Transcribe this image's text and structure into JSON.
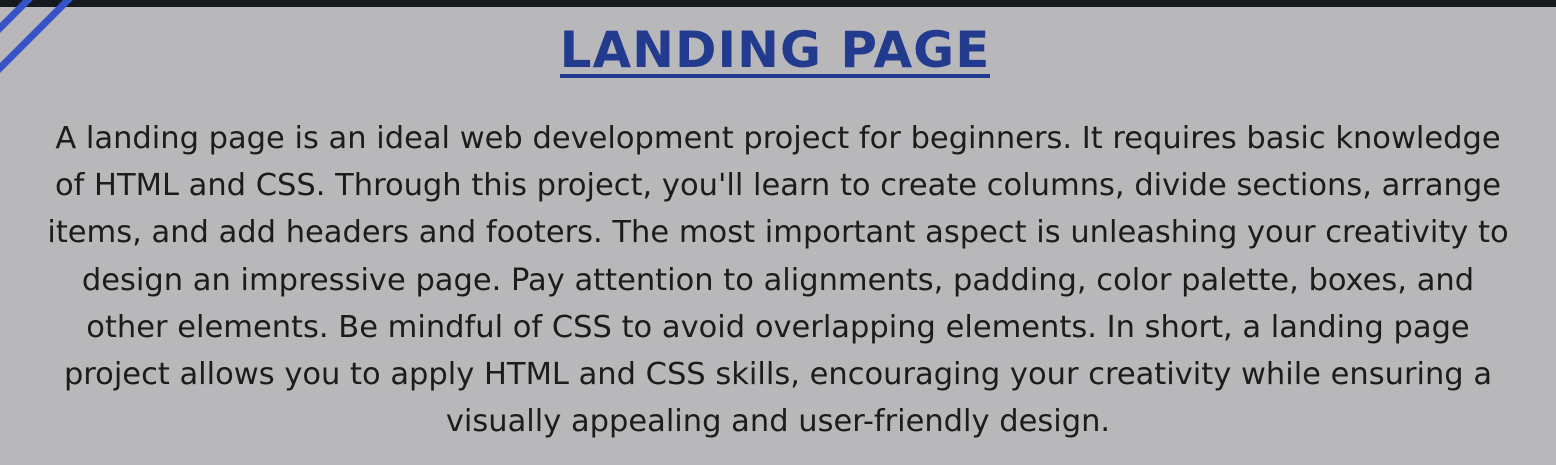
{
  "header": {
    "title": "LANDING PAGE"
  },
  "content": {
    "paragraph": "A landing page is an ideal web development project for beginners. It requires basic knowledge of HTML and CSS. Through this project, you'll learn to create columns, divide sections, arrange items, and add headers and footers. The most important aspect is unleashing your creativity to design an impressive page. Pay attention to alignments, padding, color palette, boxes, and other elements. Be mindful of CSS to avoid overlapping elements. In short, a landing page project allows you to apply HTML and CSS skills, encouraging your creativity while ensuring a visually appealing and user-friendly design."
  },
  "decoration": {
    "corner_stripes": "diagonal-stripes-icon",
    "stripe_color": "#3552c6",
    "title_color": "#233b8f",
    "background_color": "#b8b8ba"
  }
}
